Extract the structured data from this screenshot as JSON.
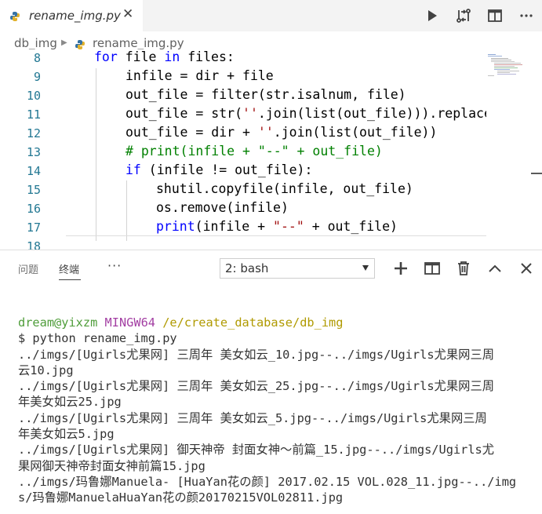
{
  "tab": {
    "filename": "rename_img.py",
    "close_glyph": "✕"
  },
  "toolbar_icons": [
    "run-icon",
    "git-compare-icon",
    "split-editor-icon",
    "more-actions-icon"
  ],
  "breadcrumb": {
    "folder": "db_img",
    "file": "rename_img.py"
  },
  "editor": {
    "lines": [
      {
        "num": "8",
        "indent": 0
      },
      {
        "num": "9",
        "indent": 1
      },
      {
        "num": "10",
        "indent": 1
      },
      {
        "num": "11",
        "indent": 1
      },
      {
        "num": "12",
        "indent": 1
      },
      {
        "num": "13",
        "indent": 1
      },
      {
        "num": "14",
        "indent": 1
      },
      {
        "num": "15",
        "indent": 2
      },
      {
        "num": "16",
        "indent": 2
      },
      {
        "num": "17",
        "indent": 2
      },
      {
        "num": "18",
        "indent": 0
      }
    ],
    "code": {
      "l8_kw_for": "for",
      "l8_a": " file ",
      "l8_kw_in": "in",
      "l8_b": " files:",
      "l9": "infile = dir + file",
      "l10": "out_file = filter(str.isalnum, file)",
      "l11_a": "out_file = str(",
      "l11_s": "''",
      "l11_b": ".join(list(out_file))).replace(",
      "l12_a": "out_file = dir + ",
      "l12_s": "''",
      "l12_b": ".join(list(out_file))",
      "l13": "# print(infile + \"--\" + out_file)",
      "l14_kw": "if",
      "l14_b": " (infile != out_file):",
      "l15": "shutil.copyfile(infile, out_file)",
      "l16": "os.remove(infile)",
      "l17_kw": "print",
      "l17_a": "(infile + ",
      "l17_s": "\"--\"",
      "l17_b": " + out_file)"
    }
  },
  "panel": {
    "tabs": [
      {
        "label": "问题"
      },
      {
        "label": "终端"
      }
    ],
    "more": "···",
    "terminal_select": "2: bash",
    "actions": [
      "add-terminal-icon",
      "split-terminal-icon",
      "trash-icon",
      "maximize-panel-icon",
      "close-panel-icon"
    ]
  },
  "terminal": {
    "prompt_user": "dream@yixzm",
    "prompt_env": "MINGW64",
    "prompt_path": "/e/create_database/db_img",
    "command": "$ python rename_img.py",
    "output": [
      "../imgs/[Ugirls尤果网] 三周年 美女如云_10.jpg--../imgs/Ugirls尤果网三周",
      "云10.jpg",
      "../imgs/[Ugirls尤果网] 三周年 美女如云_25.jpg--../imgs/Ugirls尤果网三周",
      "年美女如云25.jpg",
      "../imgs/[Ugirls尤果网] 三周年 美女如云_5.jpg--../imgs/Ugirls尤果网三周",
      "年美女如云5.jpg",
      "../imgs/[Ugirls尤果网] 御天神帝 封面女神～前篇_15.jpg--../imgs/Ugirls尤",
      "果网御天神帝封面女神前篇15.jpg",
      "../imgs/玛鲁娜Manuela- [HuaYan花の颜] 2017.02.15 VOL.028_11.jpg--../img",
      "s/玛鲁娜ManuelaHuaYan花の颜20170215VOL02811.jpg"
    ]
  },
  "colors": {
    "accent_keyword": "#0000ff",
    "string": "#a31515",
    "comment": "#008000",
    "line_number": "#237893",
    "prompt_user": "#4f9d3a",
    "prompt_env": "#a33fa3",
    "prompt_path": "#b09a00"
  }
}
